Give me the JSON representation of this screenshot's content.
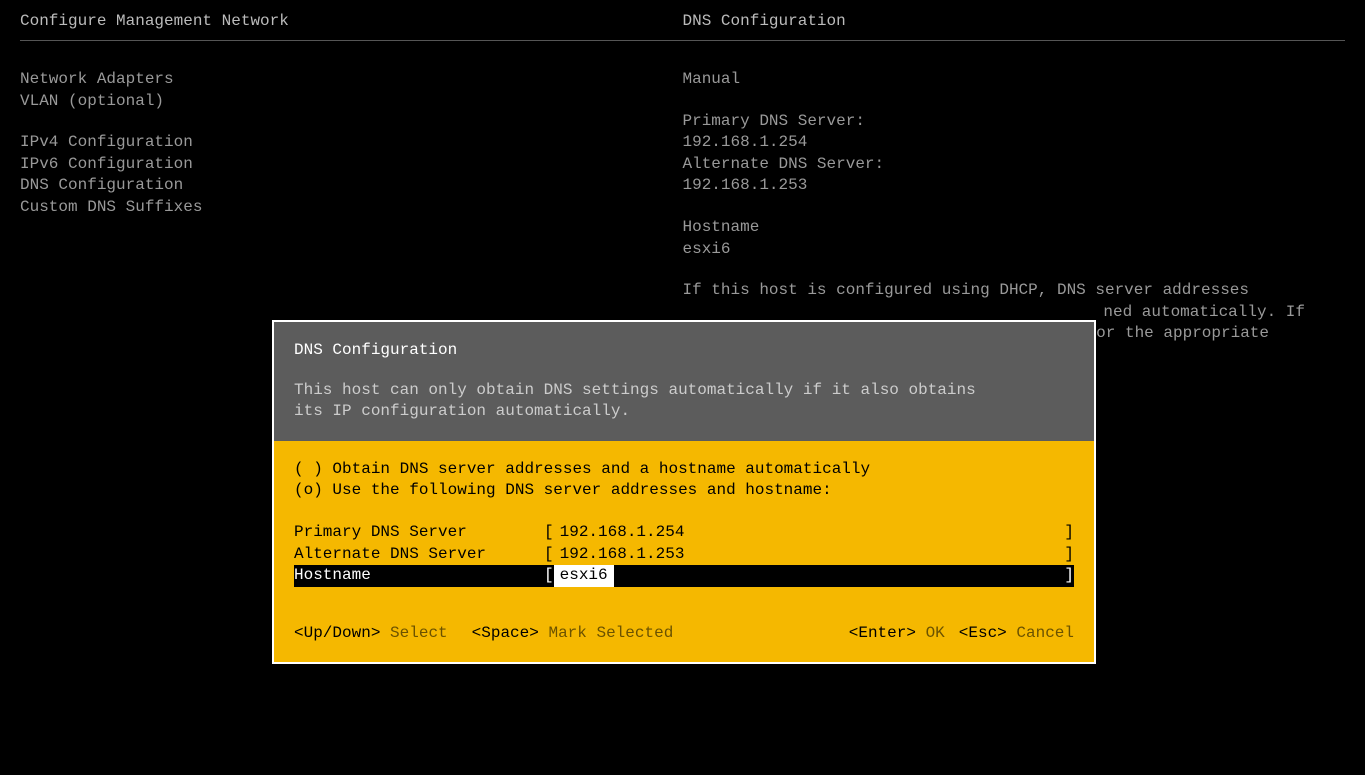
{
  "header": {
    "left_title": "Configure Management Network",
    "right_title": "DNS Configuration"
  },
  "menu": {
    "items": [
      "Network Adapters",
      "VLAN (optional)",
      "",
      "IPv4 Configuration",
      "IPv6 Configuration",
      "DNS Configuration",
      "Custom DNS Suffixes"
    ]
  },
  "info": {
    "mode": "Manual",
    "primary_label": "Primary DNS Server:",
    "primary_value": "192.168.1.254",
    "alternate_label": "Alternate DNS Server:",
    "alternate_value": "192.168.1.253",
    "hostname_label": "Hostname",
    "hostname_value": "esxi6",
    "help_line1": "If this host is configured using DHCP, DNS server addresses",
    "help_line2": "ned automatically. If",
    "help_line3": "or the appropriate"
  },
  "dialog": {
    "title": "DNS Configuration",
    "subtitle_line1": "This host can only obtain DNS settings automatically if it also obtains",
    "subtitle_line2": "its IP configuration automatically.",
    "radio1": "( ) Obtain DNS server addresses and a hostname automatically",
    "radio2": "(o) Use the following DNS server addresses and hostname:",
    "fields": {
      "primary_label": "Primary DNS Server",
      "primary_value": "192.168.1.254",
      "alternate_label": "Alternate DNS Server",
      "alternate_value": "192.168.1.253",
      "hostname_label": "Hostname",
      "hostname_value": "esxi6"
    },
    "footer": {
      "updown_key": "<Up/Down>",
      "updown_action": "Select",
      "space_key": "<Space>",
      "space_action": "Mark Selected",
      "enter_key": "<Enter>",
      "enter_action": "OK",
      "esc_key": "<Esc>",
      "esc_action": "Cancel"
    }
  }
}
